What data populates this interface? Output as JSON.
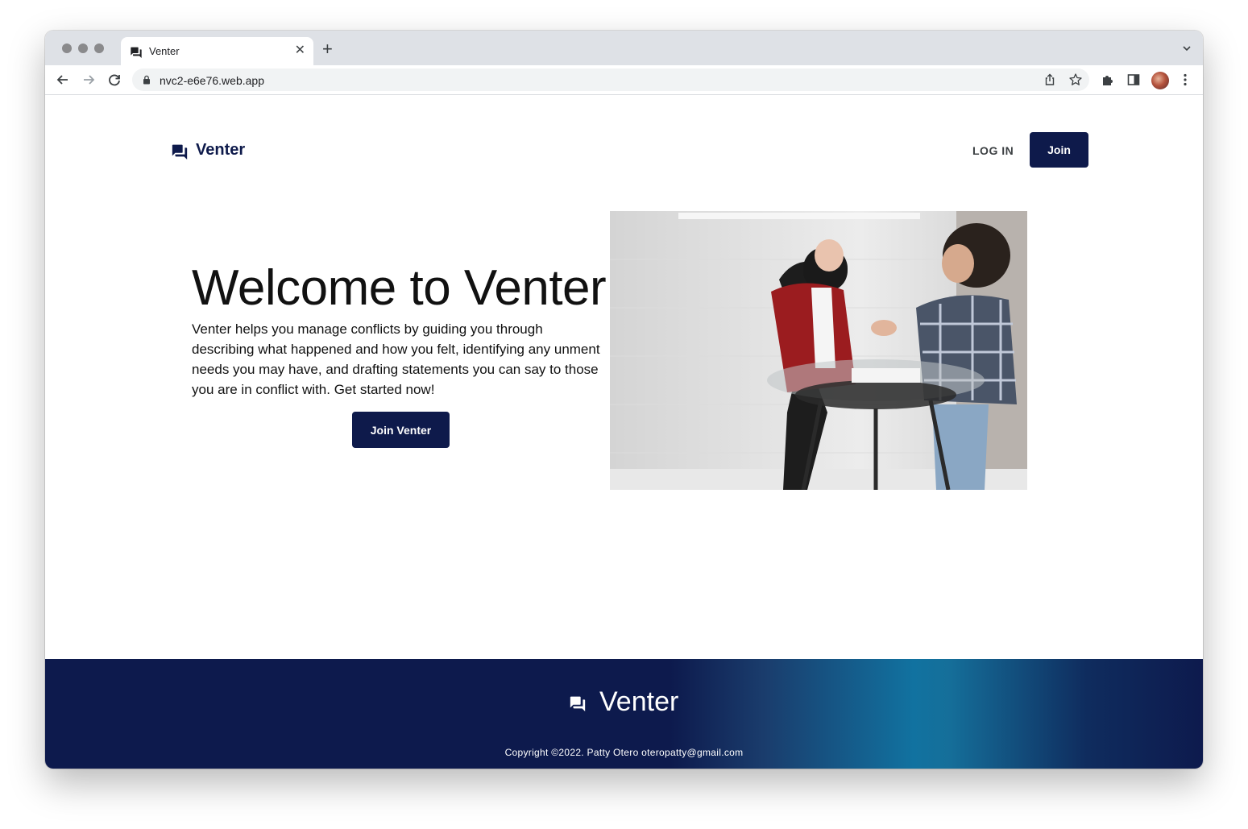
{
  "browser": {
    "tab_title": "Venter",
    "url": "nvc2-e6e76.web.app"
  },
  "header": {
    "brand": "Venter",
    "login_label": "LOG IN",
    "join_label": "Join"
  },
  "hero": {
    "title": "Welcome to Venter",
    "description": "Venter helps you manage conflicts by guiding you through describing what happened and how you felt, identifying any unment needs you may have, and drafting statements you can say to those you are in conflict with. Get started now!",
    "cta_label": "Join Venter"
  },
  "footer": {
    "brand": "Venter",
    "copyright": "Copyright ©2022. Patty Otero oteropatty@gmail.com"
  },
  "colors": {
    "brand_navy": "#0e1a4b",
    "footer_teal": "#1172a0"
  }
}
